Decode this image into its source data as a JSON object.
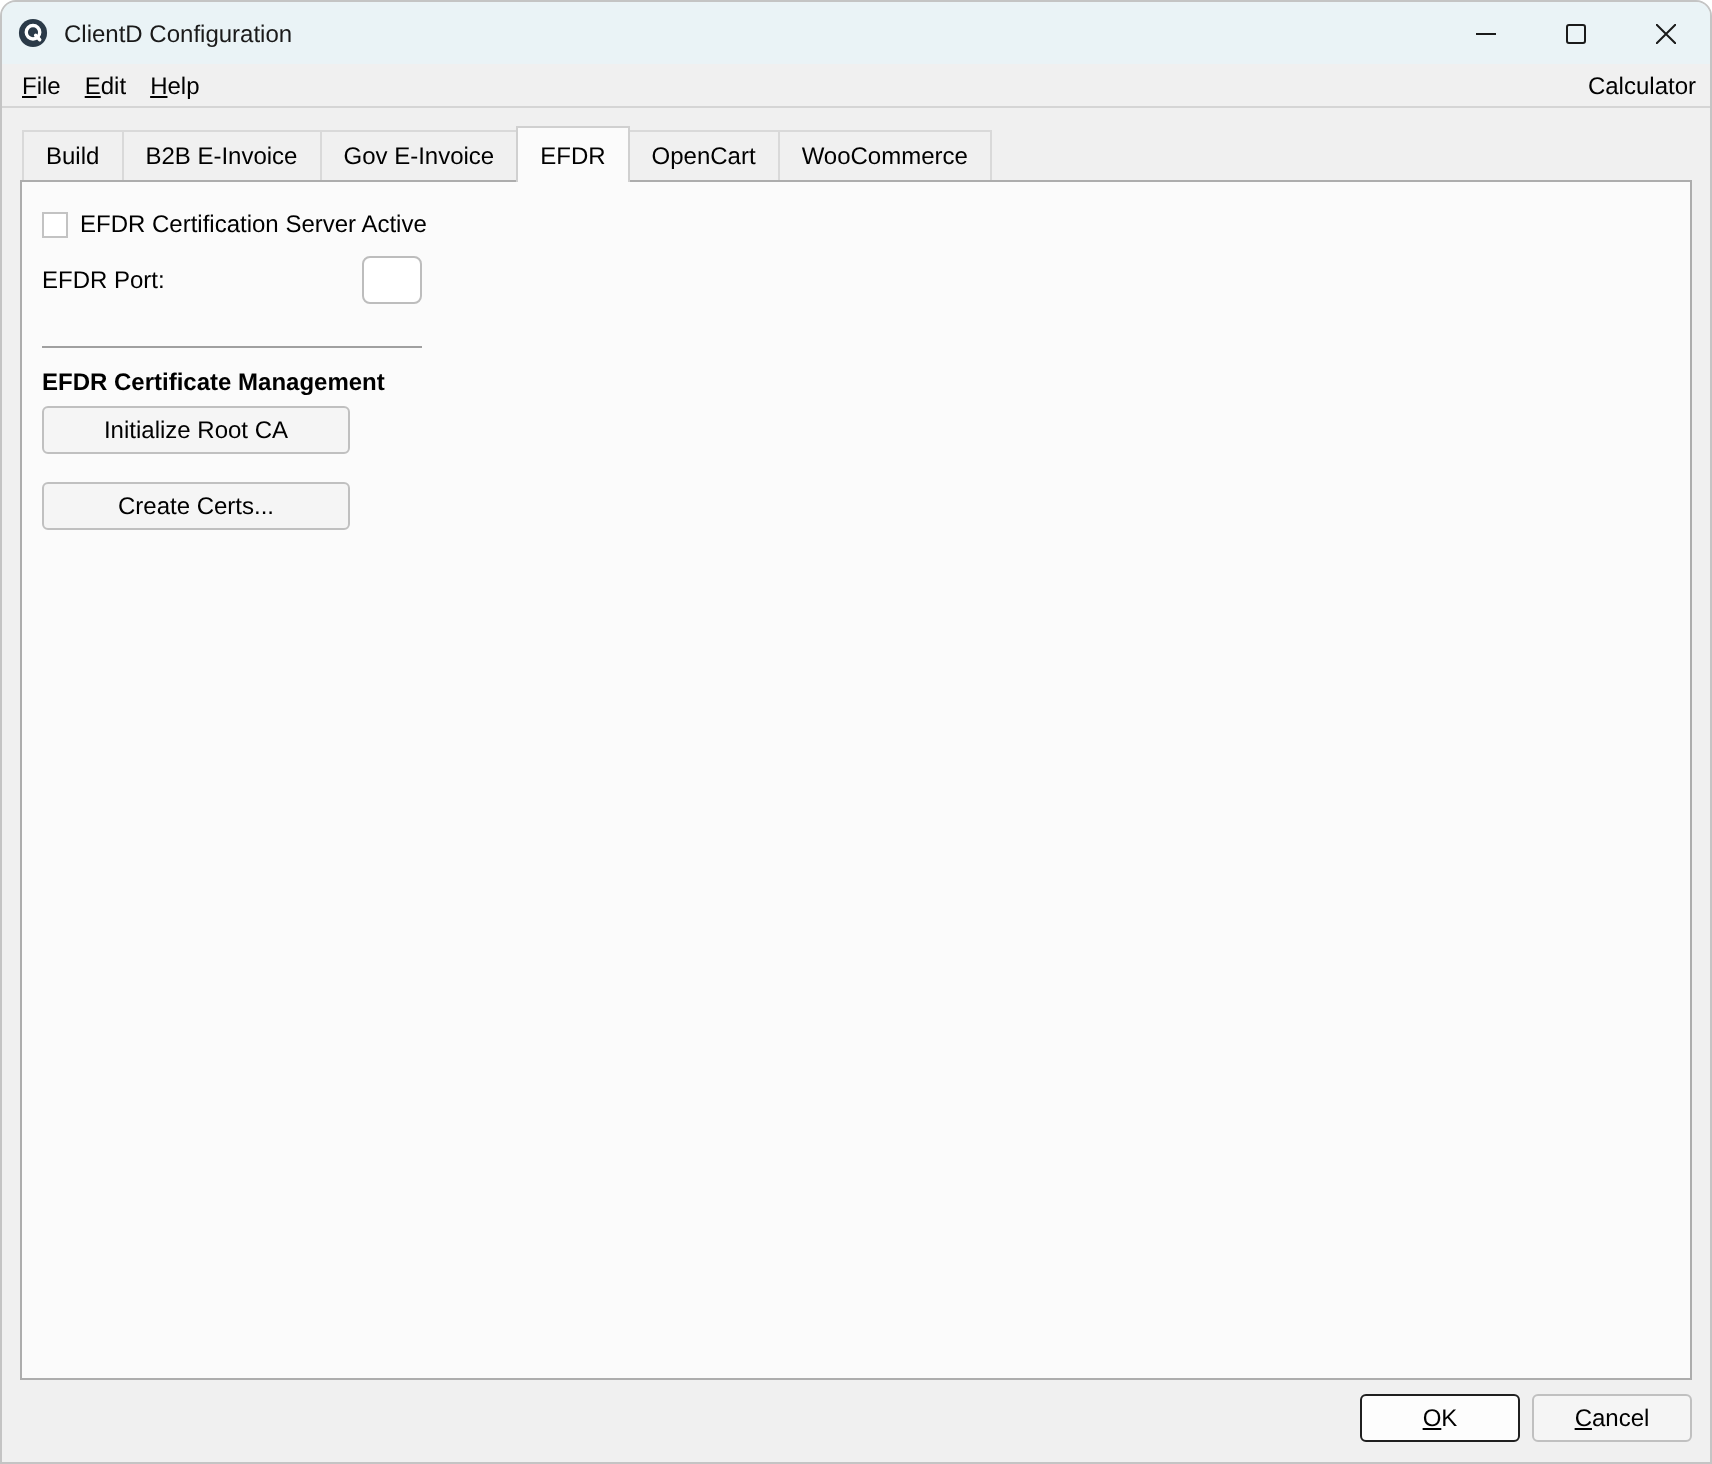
{
  "window": {
    "title": "ClientD Configuration"
  },
  "menu": [
    {
      "label": "File",
      "mnemonic": true
    },
    {
      "label": "Edit",
      "mnemonic": true
    },
    {
      "label": "Help",
      "mnemonic": true
    }
  ],
  "menu_right": {
    "label": "Calculator"
  },
  "tabs": [
    {
      "label": "Build",
      "selected": false
    },
    {
      "label": "B2B E-Invoice",
      "selected": false
    },
    {
      "label": "Gov E-Invoice",
      "selected": false
    },
    {
      "label": "EFDR",
      "selected": true
    },
    {
      "label": "OpenCart",
      "selected": false
    },
    {
      "label": "WooCommerce",
      "selected": false
    }
  ],
  "efdr": {
    "server_active": {
      "label": "EFDR Certification Server Active",
      "checked": false
    },
    "port": {
      "label": "EFDR Port:"
    },
    "section_title": "EFDR Certificate Management",
    "buttons": [
      {
        "label": "Initialize Root CA"
      },
      {
        "label": "Create Certs..."
      }
    ]
  },
  "dialog_buttons": [
    {
      "label": "OK",
      "mnemonic": true,
      "default": true
    },
    {
      "label": "Cancel",
      "mnemonic": true,
      "default": false
    }
  ]
}
